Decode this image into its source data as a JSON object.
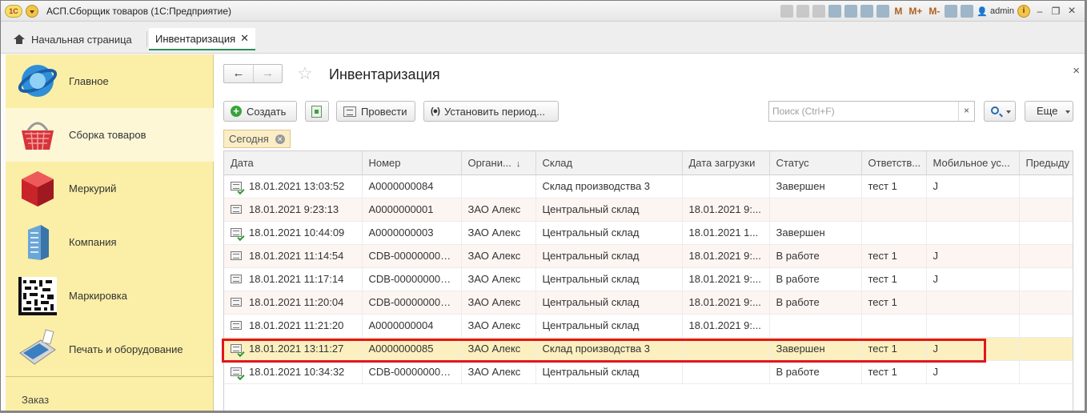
{
  "titlebar": {
    "logo_text": "1С",
    "title": "АСП.Сборщик товаров  (1С:Предприятие)",
    "m_buttons": [
      "M",
      "M+",
      "M-"
    ],
    "user": "admin",
    "info_label": "i"
  },
  "tabs": {
    "home_label": "Начальная страница",
    "active_label": "Инвентаризация",
    "close_glyph": "✕"
  },
  "sidebar": {
    "items": [
      {
        "label": "Главное",
        "icon": "globe-logo-icon"
      },
      {
        "label": "Сборка товаров",
        "icon": "basket-icon"
      },
      {
        "label": "Меркурий",
        "icon": "cube-icon"
      },
      {
        "label": "Компания",
        "icon": "building-icon"
      },
      {
        "label": "Маркировка",
        "icon": "datamatrix-icon"
      },
      {
        "label": "Печать и оборудование",
        "icon": "terminal-icon"
      }
    ],
    "active_index": 1,
    "bottom_label": "Заказ"
  },
  "content": {
    "title": "Инвентаризация",
    "back_glyph": "←",
    "forward_glyph": "→",
    "star_glyph": "☆",
    "close_glyph": "×",
    "toolbar": {
      "create_label": "Создать",
      "post_label": "Провести",
      "period_label": "Установить период...",
      "period_icon": "(●)",
      "more_label": "Еще"
    },
    "search": {
      "placeholder": "Поиск (Ctrl+F)",
      "clear_glyph": "×"
    },
    "filter_chip": {
      "label": "Сегодня",
      "clear_glyph": "✕"
    }
  },
  "table": {
    "columns": [
      "Дата",
      "Номер",
      "Органи...",
      "Склад",
      "Дата загрузки",
      "Статус",
      "Ответств...",
      "Мобильное ус...",
      "Предыду"
    ],
    "sort_glyph": "↓",
    "rows": [
      {
        "date": "18.01.2021 13:03:52",
        "number": "A0000000084",
        "org": "",
        "warehouse": "Склад производства 3",
        "load_date": "",
        "status": "Завершен",
        "resp": "тест 1",
        "mobile": "J",
        "prev": "",
        "posted": true
      },
      {
        "date": "18.01.2021 9:23:13",
        "number": "A0000000001",
        "org": "ЗАО Алекс",
        "warehouse": "Центральный склад",
        "load_date": "18.01.2021 9:...",
        "status": "",
        "resp": "",
        "mobile": "",
        "prev": "",
        "posted": false
      },
      {
        "date": "18.01.2021 10:44:09",
        "number": "A0000000003",
        "org": "ЗАО Алекс",
        "warehouse": "Центральный склад",
        "load_date": "18.01.2021 1...",
        "status": "Завершен",
        "resp": "",
        "mobile": "",
        "prev": "",
        "posted": true
      },
      {
        "date": "18.01.2021 11:14:54",
        "number": "CDB-000000000...",
        "org": "ЗАО Алекс",
        "warehouse": "Центральный склад",
        "load_date": "18.01.2021 9:...",
        "status": "В работе",
        "resp": "тест 1",
        "mobile": "J",
        "prev": "",
        "posted": false
      },
      {
        "date": "18.01.2021 11:17:14",
        "number": "CDB-000000000...",
        "org": "ЗАО Алекс",
        "warehouse": "Центральный склад",
        "load_date": "18.01.2021 9:...",
        "status": "В работе",
        "resp": "тест 1",
        "mobile": "J",
        "prev": "",
        "posted": false
      },
      {
        "date": "18.01.2021 11:20:04",
        "number": "CDB-000000000...",
        "org": "ЗАО Алекс",
        "warehouse": "Центральный склад",
        "load_date": "18.01.2021 9:...",
        "status": "В работе",
        "resp": "тест 1",
        "mobile": "",
        "prev": "",
        "posted": false
      },
      {
        "date": "18.01.2021 11:21:20",
        "number": "A0000000004",
        "org": "ЗАО Алекс",
        "warehouse": "Центральный склад",
        "load_date": "18.01.2021 9:...",
        "status": "",
        "resp": "",
        "mobile": "",
        "prev": "",
        "posted": false
      },
      {
        "date": "18.01.2021 13:11:27",
        "number": "A0000000085",
        "org": "ЗАО Алекс",
        "warehouse": "Склад производства 3",
        "load_date": "",
        "status": "Завершен",
        "resp": "тест 1",
        "mobile": "J",
        "prev": "",
        "posted": true
      },
      {
        "date": "18.01.2021 10:34:32",
        "number": "CDB-000000000...",
        "org": "ЗАО Алекс",
        "warehouse": "Центральный склад",
        "load_date": "",
        "status": "В работе",
        "resp": "тест 1",
        "mobile": "J",
        "prev": "",
        "posted": true
      }
    ],
    "selected_index": 7
  },
  "colors": {
    "sidebar_bg": "#fbeea7",
    "accent_green": "#2e8b57",
    "selection_row": "#fdf0c0",
    "highlight_border": "#e0161e"
  }
}
